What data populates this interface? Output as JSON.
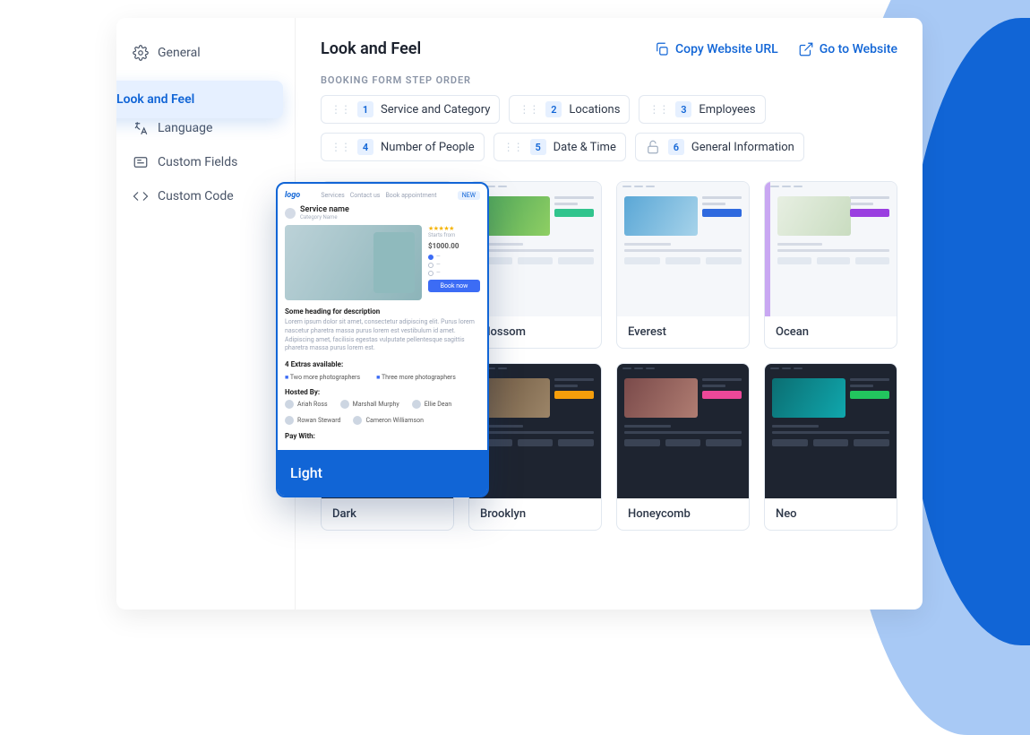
{
  "sidebar": {
    "items": [
      {
        "label": "General"
      },
      {
        "label": "Look and Feel"
      },
      {
        "label": "Language"
      },
      {
        "label": "Custom Fields"
      },
      {
        "label": "Custom Code"
      }
    ]
  },
  "header": {
    "title": "Look and Feel",
    "copy_url": "Copy Website URL",
    "goto_site": "Go to Website"
  },
  "steps": {
    "section_label": "BOOKING FORM STEP ORDER",
    "items": [
      {
        "num": "1",
        "label": "Service and Category",
        "locked": false
      },
      {
        "num": "2",
        "label": "Locations",
        "locked": false
      },
      {
        "num": "3",
        "label": "Employees",
        "locked": false
      },
      {
        "num": "4",
        "label": "Number of People",
        "locked": false
      },
      {
        "num": "5",
        "label": "Date & Time",
        "locked": false
      },
      {
        "num": "6",
        "label": "General Information",
        "locked": true
      }
    ]
  },
  "themes": {
    "light_featured": "Light",
    "row1": [
      "Light",
      "Blossom",
      "Everest",
      "Ocean"
    ],
    "row2": [
      "Dark",
      "Brooklyn",
      "Honeycomb",
      "Neo"
    ],
    "featured_preview": {
      "logo": "logo",
      "nav": [
        "Services",
        "Contact us",
        "Book appointment"
      ],
      "badge": "NEW",
      "service_name": "Service name",
      "service_sub": "Category Name",
      "price": "$1000.00",
      "sub_heading": "Some heading for description",
      "desc": "Lorem ipsum dolor sit amet, consectetur adipiscing elit. Purus lorem nascetur pharetra massa purus lorem est vestibulum id amet. Adipiscing amet, facilisis egestas vulputate pellentesque sagittis pharetra massa purus lorem est.",
      "extras_heading": "4 Extras available:",
      "extras": [
        "Two more photographers",
        "Three more photographers"
      ],
      "hosted_heading": "Hosted By:",
      "hosts": [
        "Ariah Ross",
        "Marshall Murphy",
        "Ellie Dean",
        "Rowan Steward",
        "Cameron Williamson"
      ],
      "pay_heading": "Pay With:",
      "cta": "Book now"
    }
  }
}
